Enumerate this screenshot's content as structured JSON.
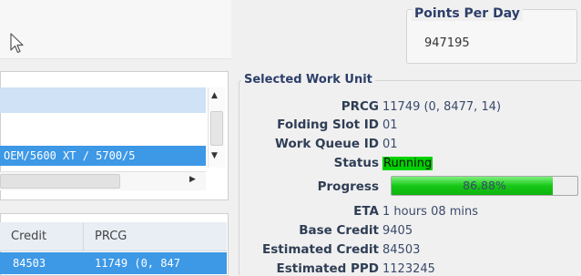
{
  "points_per_day": {
    "title": "Points Per Day",
    "value": "947195"
  },
  "list": {
    "row_text": "OEM/5600 XT / 5700/5",
    "scroll_up_glyph": "▲",
    "scroll_down_glyph": "▼",
    "scroll_right_glyph": "▶"
  },
  "table": {
    "columns": [
      "Credit",
      "PRCG"
    ],
    "row": {
      "credit": "84503",
      "prcg": "11749 (0, 847"
    }
  },
  "work_unit": {
    "title": "Selected Work Unit",
    "prcg_label": "PRCG",
    "prcg_value": "11749 (0, 8477, 14)",
    "slot_label": "Folding Slot ID",
    "slot_value": "01",
    "queue_label": "Work Queue ID",
    "queue_value": "01",
    "status_label": "Status",
    "status_value": "Running",
    "status_color": "#00d100",
    "progress_label": "Progress",
    "progress_text": "86.88%",
    "progress_fraction": 0.8688,
    "eta_label": "ETA",
    "eta_value": "1 hours 08 mins",
    "base_credit_label": "Base Credit",
    "base_credit_value": "9405",
    "est_credit_label": "Estimated Credit",
    "est_credit_value": "84503",
    "est_ppd_label": "Estimated PPD",
    "est_ppd_value": "1123245"
  },
  "icons": {
    "cursor": "mouse-pointer-icon"
  },
  "colors": {
    "selection": "#3d98e6",
    "highlight": "#cfe2f6",
    "progress_green": "#16c816"
  }
}
